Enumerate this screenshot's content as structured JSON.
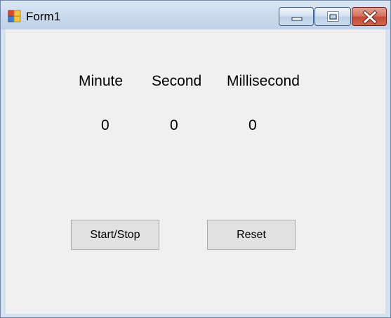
{
  "window": {
    "title": "Form1",
    "app_icon": "windows-forms-icon"
  },
  "caption_buttons": {
    "minimize_icon": "minimize-icon",
    "maximize_icon": "maximize-icon",
    "close_icon": "close-icon",
    "close_color": "#c7503a"
  },
  "form": {
    "headers": {
      "minute": "Minute",
      "second": "Second",
      "millisecond": "Millisecond"
    },
    "values": {
      "minute": "0",
      "second": "0",
      "millisecond": "0"
    },
    "buttons": {
      "start_stop": "Start/Stop",
      "reset": "Reset"
    }
  }
}
